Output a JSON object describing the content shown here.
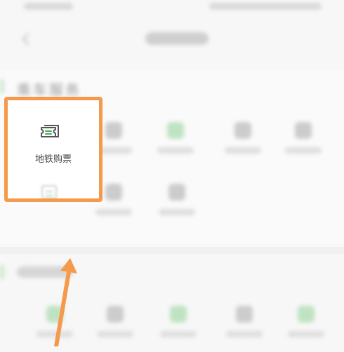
{
  "section": {
    "title": "乘车服务"
  },
  "highlighted_tile": {
    "label": "地铁购票",
    "icon": "ticket-icon"
  },
  "colors": {
    "highlight": "#f59a4d",
    "accent_green": "#3fae5a",
    "icon_gray": "#555555"
  }
}
